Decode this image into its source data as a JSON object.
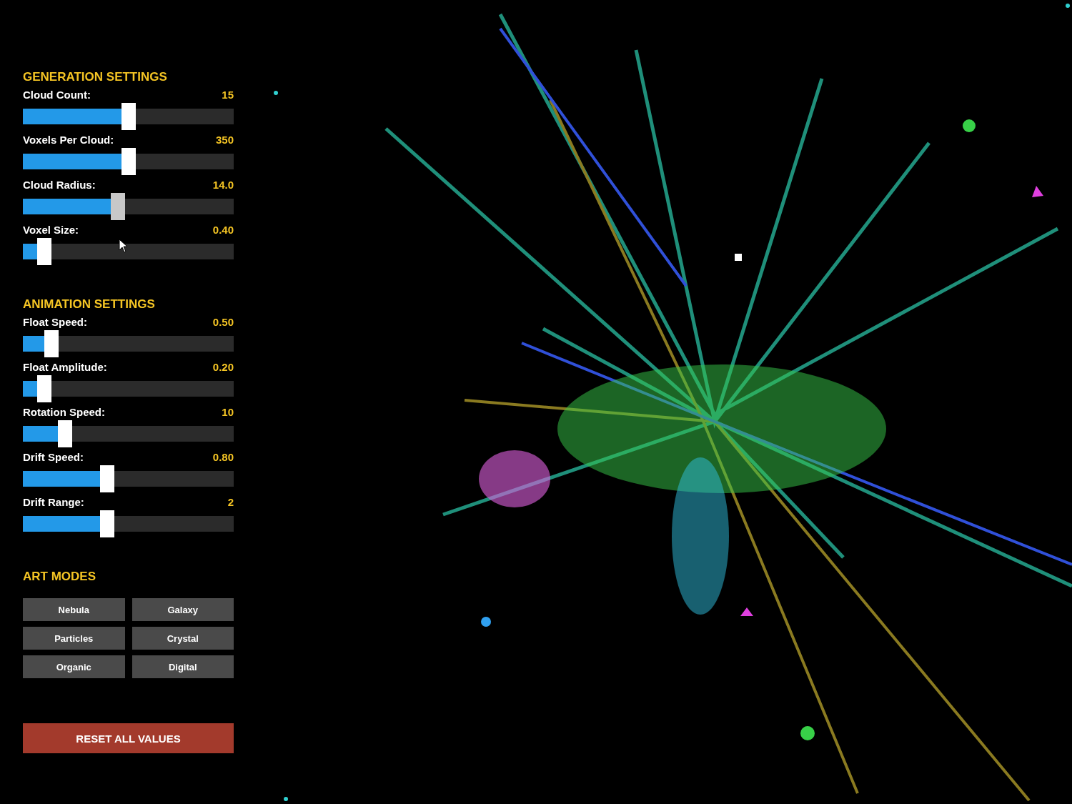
{
  "sections": [
    {
      "title": "GENERATION SETTINGS",
      "sliders": [
        {
          "label": "Cloud Count:",
          "value": "15",
          "level": 0.5,
          "active": false
        },
        {
          "label": "Voxels Per Cloud:",
          "value": "350",
          "level": 0.5,
          "active": false
        },
        {
          "label": "Cloud Radius:",
          "value": "14.0",
          "level": 0.45,
          "active": true
        },
        {
          "label": "Voxel Size:",
          "value": "0.40",
          "level": 0.1,
          "active": false
        }
      ]
    },
    {
      "title": "ANIMATION SETTINGS",
      "sliders": [
        {
          "label": "Float Speed:",
          "value": "0.50",
          "level": 0.135,
          "active": false
        },
        {
          "label": "Float Amplitude:",
          "value": "0.20",
          "level": 0.1,
          "active": false
        },
        {
          "label": "Rotation Speed:",
          "value": "10",
          "level": 0.2,
          "active": false
        },
        {
          "label": "Drift Speed:",
          "value": "0.80",
          "level": 0.4,
          "active": false
        },
        {
          "label": "Drift Range:",
          "value": "2",
          "level": 0.4,
          "active": false
        }
      ]
    }
  ],
  "art_modes": {
    "title": "ART MODES",
    "buttons": [
      "Nebula",
      "Galaxy",
      "Particles",
      "Crystal",
      "Organic",
      "Digital"
    ]
  },
  "reset_button": "RESET ALL VALUES"
}
